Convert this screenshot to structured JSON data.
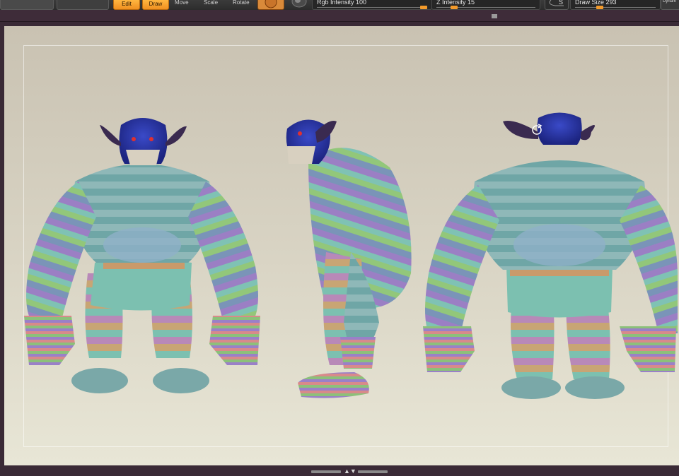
{
  "toolbar": {
    "edit_label": "Edit",
    "draw_label": "Draw",
    "move_label": "Move",
    "scale_label": "Scale",
    "rotate_label": "Rotate",
    "rgb_intensity": {
      "label": "Rgb Intensity",
      "value": "100",
      "fraction": 1.0
    },
    "z_intensity": {
      "label": "Z Intensity",
      "value": "15",
      "fraction": 0.15
    },
    "s_label": "S",
    "draw_size": {
      "label": "Draw Size",
      "value": "293",
      "fraction": 0.29
    },
    "dynamic_label": "Dynam",
    "active_color": "#f39a2a",
    "material_icon": "material-sphere-icon",
    "brush_icon": "brush-icon"
  },
  "viewport": {
    "figures": [
      "monster-front-view",
      "monster-side-view",
      "monster-back-view"
    ],
    "background_color": "#d8d3c3",
    "rotate_cursor_icon": "rotate-icon"
  },
  "statusbar": {
    "collapse_icon": "triangle-up-down-icon"
  }
}
